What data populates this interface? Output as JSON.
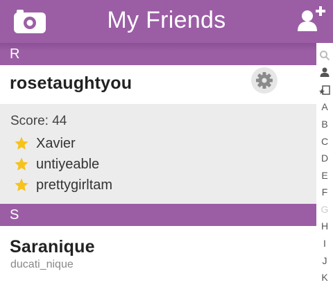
{
  "header": {
    "title": "My Friends",
    "camera_icon": "camera-icon",
    "add_friend_icon": "add-friend-icon",
    "color": "#9b5ea5"
  },
  "sections": [
    {
      "letter": "R",
      "friends": [
        {
          "name": "rosetaughtyou",
          "settings_icon": "gear-icon",
          "score_text": "Score: 44",
          "best_friends": [
            "Xavier",
            "untiyeable",
            "prettygirltam"
          ]
        }
      ]
    },
    {
      "letter": "S",
      "friends": [
        {
          "name": "Saranique",
          "username": "ducati_nique"
        }
      ]
    }
  ],
  "index_bar": {
    "icons": [
      "search-icon",
      "person-icon",
      "starred-icon"
    ],
    "letters": [
      "A",
      "B",
      "C",
      "D",
      "E",
      "F",
      "G",
      "H",
      "I",
      "J",
      "K"
    ]
  }
}
